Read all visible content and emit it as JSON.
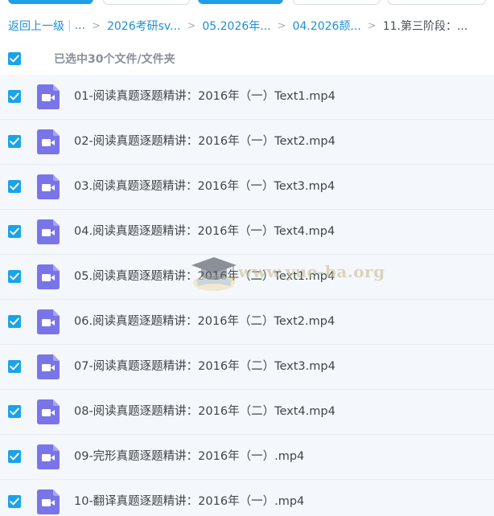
{
  "colors": {
    "accent": "#1aa3e8",
    "link": "#1c8fd6",
    "row_bg": "#f4f8fc",
    "video_icon": "#7b74e8"
  },
  "breadcrumb": {
    "back": "返回上一级",
    "separator_bar": "|",
    "ellipsis": "...",
    "separator": ">",
    "items": [
      "2026考研sv...",
      "05.2026年...",
      "04.2026颉...",
      "11.第三阶段：..."
    ]
  },
  "selection": {
    "label": "已选中30个文件/文件夹",
    "checked": true
  },
  "files": [
    {
      "name": "01-阅读真题逐题精讲：2016年（一）Text1.mp4",
      "icon": "video-file-icon",
      "checked": true
    },
    {
      "name": "02-阅读真题逐题精讲：2016年（一）Text2.mp4",
      "icon": "video-file-icon",
      "checked": true
    },
    {
      "name": "03.阅读真题逐题精讲：2016年（一）Text3.mp4",
      "icon": "video-file-icon",
      "checked": true
    },
    {
      "name": "04.阅读真题逐题精讲：2016年（一）Text4.mp4",
      "icon": "video-file-icon",
      "checked": true
    },
    {
      "name": "05.阅读真题逐题精讲：2016年（二）Text1.mp4",
      "icon": "video-file-icon",
      "checked": true
    },
    {
      "name": "06.阅读真题逐题精讲：2016年（二）Text2.mp4",
      "icon": "video-file-icon",
      "checked": true
    },
    {
      "name": "07-阅读真题逐题精讲：2016年（二）Text3.mp4",
      "icon": "video-file-icon",
      "checked": true
    },
    {
      "name": "08-阅读真题逐题精讲：2016年（二）Text4.mp4",
      "icon": "video-file-icon",
      "checked": true
    },
    {
      "name": "09-完形真题逐题精讲：2016年（一）.mp4",
      "icon": "video-file-icon",
      "checked": true
    },
    {
      "name": "10-翻译真题逐题精讲：2016年（一）.mp4",
      "icon": "video-file-icon",
      "checked": true
    }
  ],
  "watermark": {
    "text": "www.yue-ba.org",
    "icon": "graduation-cap-icon"
  }
}
